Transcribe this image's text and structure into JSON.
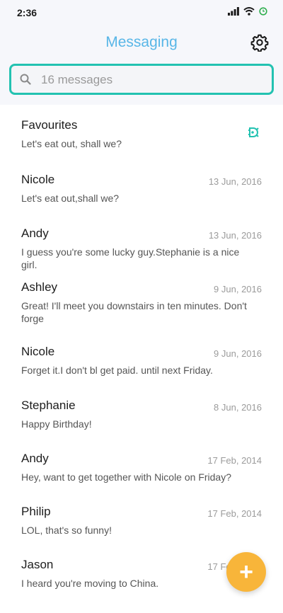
{
  "status_bar": {
    "time": "2:36"
  },
  "header": {
    "title": "Messaging"
  },
  "search": {
    "placeholder": "16 messages"
  },
  "messages": [
    {
      "name": "Favourites",
      "preview": "Let's eat out, shall we?",
      "date": ""
    },
    {
      "name": "Nicole",
      "preview": "Let's eat out,shall we?",
      "date": "13 Jun, 2016"
    },
    {
      "name": "Andy",
      "preview": "I guess you're some lucky guy.Stephanie is a nice girl.",
      "date": "13 Jun, 2016"
    },
    {
      "name": "Ashley",
      "preview": "Great! I'll meet you downstairs in ten minutes. Don't forge",
      "date": "9 Jun, 2016"
    },
    {
      "name": "Nicole",
      "preview": "Forget it.I don't bl get paid. until next Friday.",
      "date": "9 Jun, 2016"
    },
    {
      "name": "Stephanie",
      "preview": "Happy Birthday!",
      "date": "8 Jun, 2016"
    },
    {
      "name": "Andy",
      "preview": "Hey, want to get together with Nicole on Friday?",
      "date": "17 Feb, 2014"
    },
    {
      "name": "Philip",
      "preview": "LOL, that's so funny!",
      "date": "17 Feb, 2014"
    },
    {
      "name": "Jason",
      "preview": "I heard you're moving to China.",
      "date": "17 Feb, 2014"
    }
  ],
  "fab": {
    "label": "+"
  },
  "colors": {
    "accent": "#58b6e7",
    "search_border": "#23c2b1",
    "fab": "#f8b53a",
    "fav_icon": "#23c2b1"
  }
}
